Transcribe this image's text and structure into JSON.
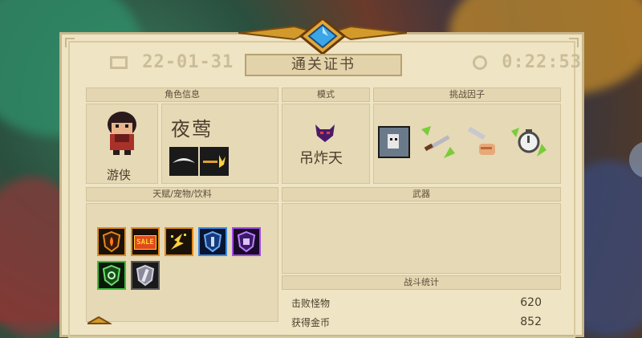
{
  "certificate": {
    "title": "通关证书",
    "date": "22-01-31",
    "clear_time": "0:22:53"
  },
  "sections": {
    "character": "角色信息",
    "mode": "模式",
    "challenge": "挑战因子",
    "talents": "天赋/宠物/饮料",
    "weapons": "武器",
    "battle_stats": "战斗统计"
  },
  "character": {
    "name": "夜莺",
    "class": "游侠"
  },
  "mode": {
    "name": "吊炸天"
  },
  "stats": [
    {
      "label": "击败怪物",
      "value": "620"
    },
    {
      "label": "获得金币",
      "value": "852"
    }
  ],
  "colors": {
    "parchment": "#efe4c3",
    "gold": "#d29a2a",
    "gem": "#3aa6e8",
    "text": "#4a3d2c"
  }
}
